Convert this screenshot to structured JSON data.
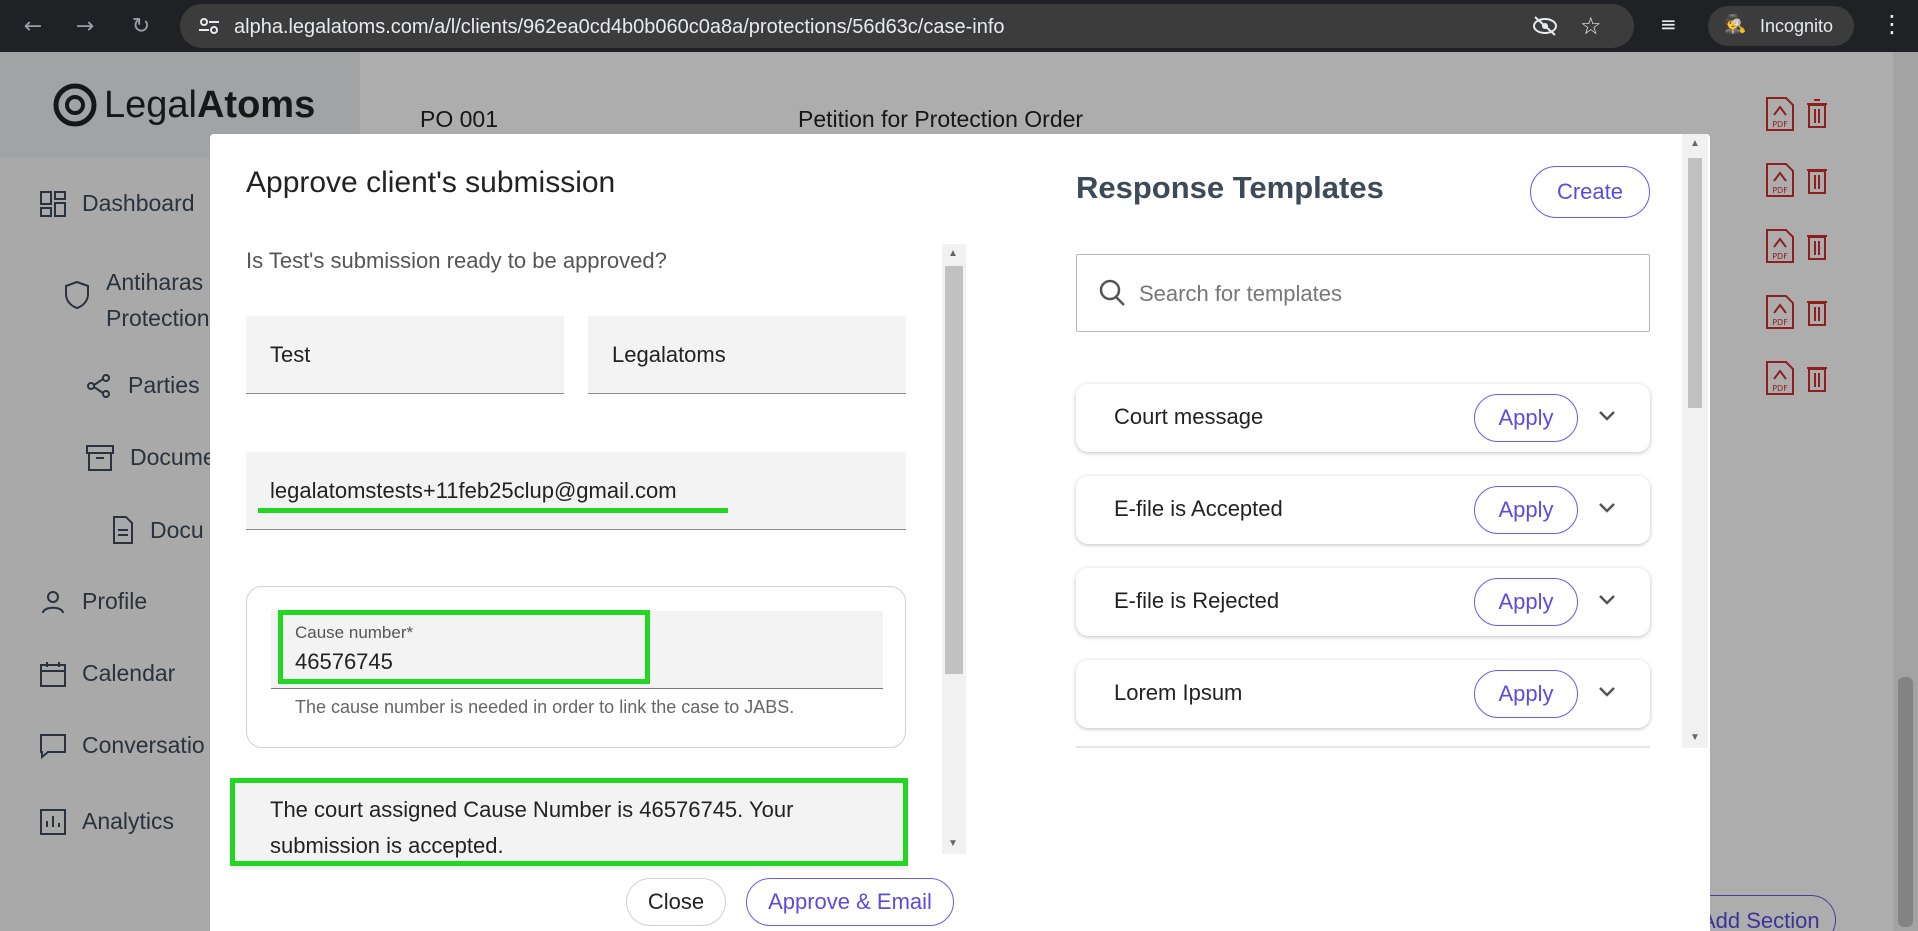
{
  "browser": {
    "url": "alpha.legalatoms.com/a/l/clients/962ea0cd4b0b060c0a8a/protections/56d63c/case-info",
    "incognito_label": "Incognito"
  },
  "sidebar": {
    "logo_light": "Legal",
    "logo_bold": "Atoms",
    "items": [
      {
        "label": "Dashboard"
      },
      {
        "label": "Antiharas"
      },
      {
        "label": "Protection"
      },
      {
        "label": "Parties"
      },
      {
        "label": "Docume"
      },
      {
        "label": "Docu"
      },
      {
        "label": "Profile"
      },
      {
        "label": "Calendar"
      },
      {
        "label": "Conversatio"
      },
      {
        "label": "Analytics"
      }
    ]
  },
  "background": {
    "doc_code": "PO 001",
    "doc_name": "Petition for Protection Order",
    "add_section_label": "Add Section"
  },
  "modal": {
    "title": "Approve client's submission",
    "question": "Is Test's submission ready to be approved?",
    "first_name": "Test",
    "last_name": "Legalatoms",
    "email": "legalatomstests+11feb25clup@gmail.com",
    "cause_label": "Cause number*",
    "cause_value": "46576745",
    "cause_hint": "The cause number is needed in order to link the case to JABS.",
    "message": "The court assigned Cause Number is 46576745. Your submission is accepted.",
    "close_label": "Close",
    "approve_label": "Approve & Email",
    "highlight_color": "#22d622"
  },
  "templates": {
    "title": "Response Templates",
    "create_label": "Create",
    "search_placeholder": "Search for templates",
    "apply_label": "Apply",
    "items": [
      {
        "name": "Court message"
      },
      {
        "name": "E-file is Accepted"
      },
      {
        "name": "E-file is Rejected"
      },
      {
        "name": "Lorem Ipsum"
      }
    ]
  },
  "colors": {
    "accent": "#5b4ce0",
    "pdf_red": "#d32f2f"
  }
}
